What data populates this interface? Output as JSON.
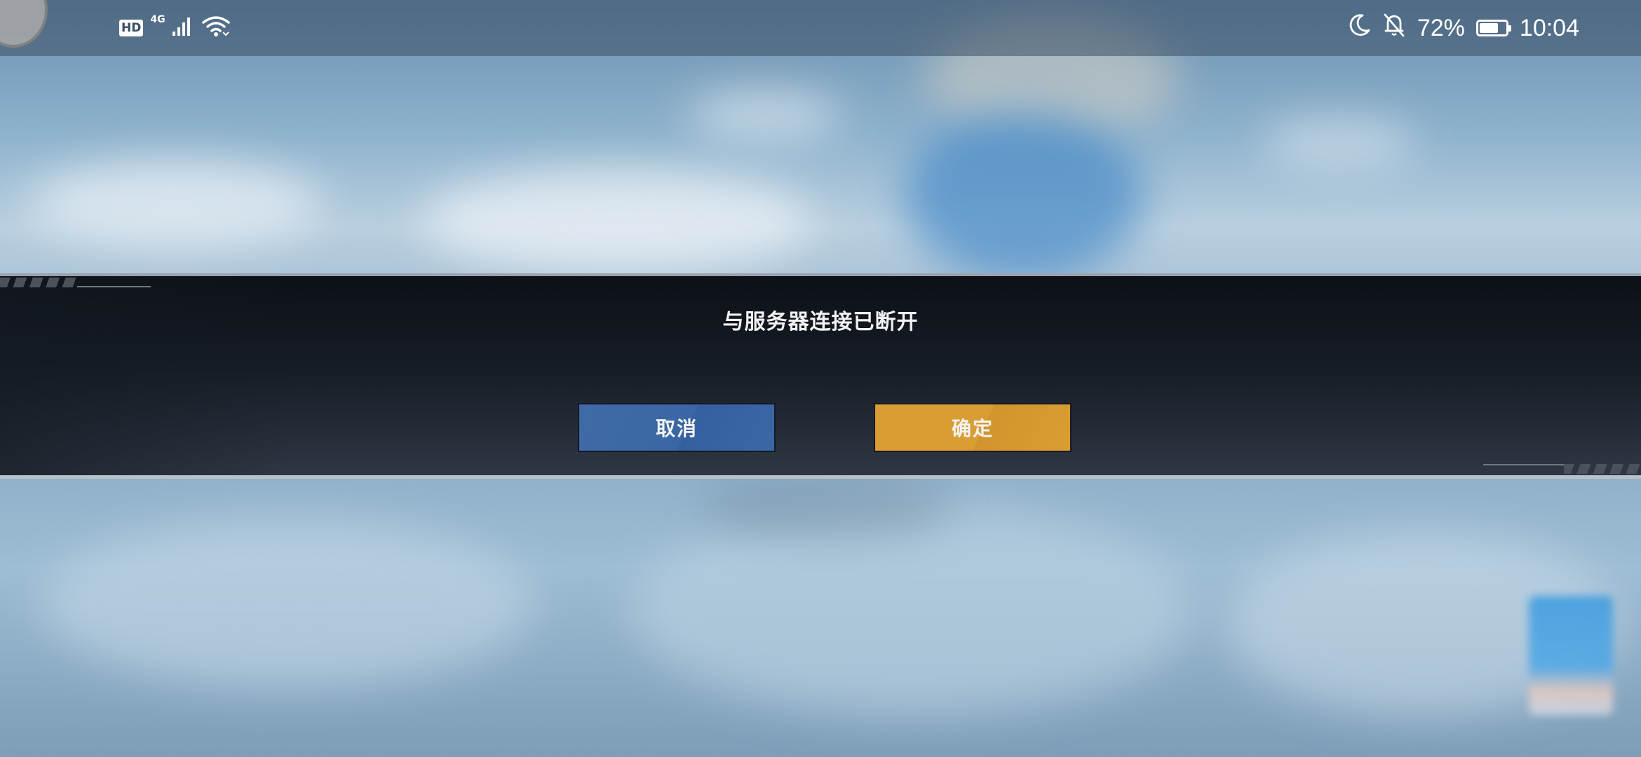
{
  "status_bar": {
    "hd_label": "HD",
    "network_label": "4G",
    "battery_percent": "72%",
    "battery_level": 0.72,
    "time": "10:04",
    "icons": [
      "signal-bars-icon",
      "wifi-icon",
      "moon-icon",
      "bell-off-icon",
      "battery-icon"
    ]
  },
  "dialog": {
    "message": "与服务器连接已断开",
    "cancel_label": "取消",
    "confirm_label": "确定"
  },
  "colors": {
    "cancel_button": "#3a67a4",
    "confirm_button": "#d99d33",
    "dialog_band": "#161c25",
    "text": "#f2f2f2"
  }
}
